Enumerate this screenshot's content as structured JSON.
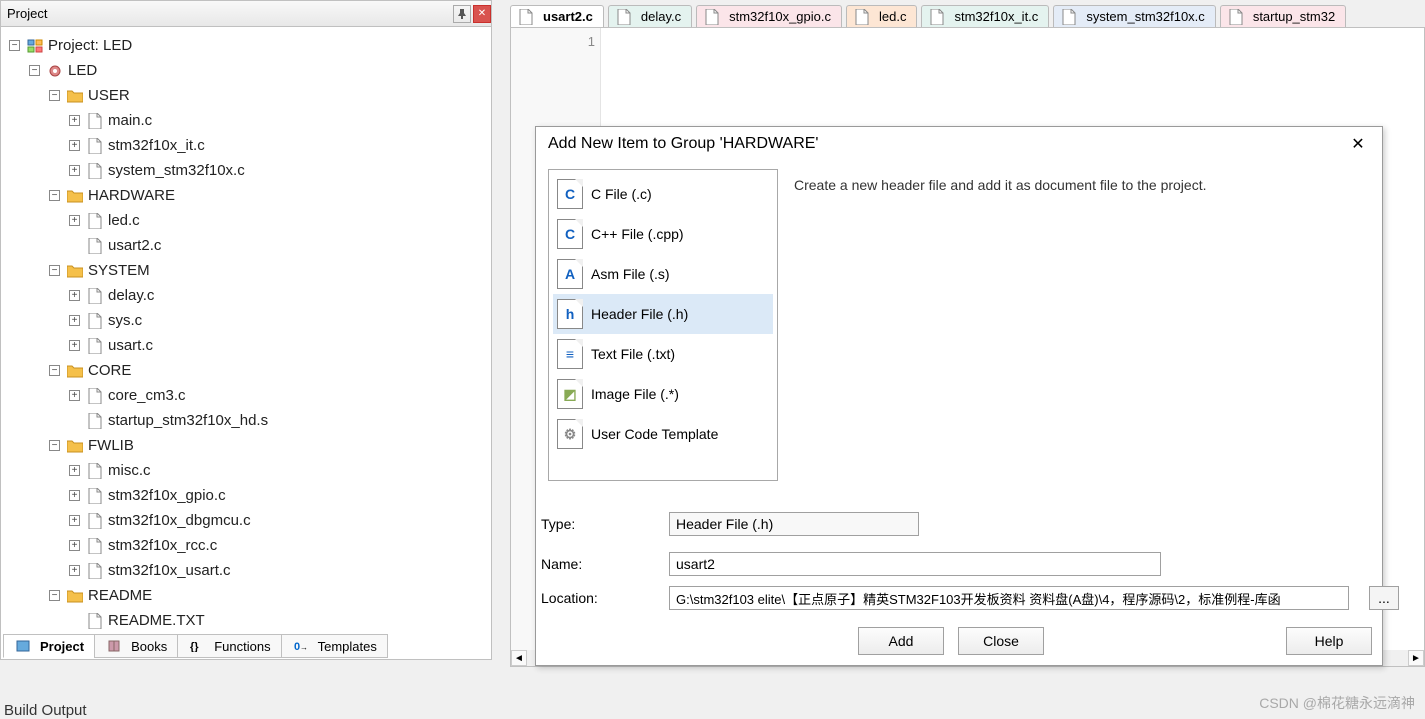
{
  "project_panel": {
    "title": "Project",
    "root": "Project: LED",
    "target": "LED",
    "groups": [
      {
        "name": "USER",
        "files": [
          "main.c",
          "stm32f10x_it.c",
          "system_stm32f10x.c"
        ]
      },
      {
        "name": "HARDWARE",
        "files": [
          "led.c",
          "usart2.c"
        ]
      },
      {
        "name": "SYSTEM",
        "files": [
          "delay.c",
          "sys.c",
          "usart.c"
        ]
      },
      {
        "name": "CORE",
        "files": [
          "core_cm3.c",
          "startup_stm32f10x_hd.s"
        ]
      },
      {
        "name": "FWLIB",
        "files": [
          "misc.c",
          "stm32f10x_gpio.c",
          "stm32f10x_dbgmcu.c",
          "stm32f10x_rcc.c",
          "stm32f10x_usart.c"
        ]
      },
      {
        "name": "README",
        "files": [
          "README.TXT"
        ]
      }
    ],
    "bottom_tabs": [
      "Project",
      "Books",
      "Functions",
      "Templates"
    ]
  },
  "editor": {
    "tabs": [
      "usart2.c",
      "delay.c",
      "stm32f10x_gpio.c",
      "led.c",
      "stm32f10x_it.c",
      "system_stm32f10x.c",
      "startup_stm32"
    ],
    "active_tab": "usart2.c",
    "line_number": "1"
  },
  "dialog": {
    "title": "Add New Item to Group 'HARDWARE'",
    "description": "Create a new header file and add it as document file to the project.",
    "types": [
      "C File (.c)",
      "C++ File (.cpp)",
      "Asm File (.s)",
      "Header File (.h)",
      "Text File (.txt)",
      "Image File (.*)",
      "User Code Template"
    ],
    "selected_type_index": 3,
    "labels": {
      "type": "Type:",
      "name": "Name:",
      "location": "Location:"
    },
    "type_value": "Header File (.h)",
    "name_value": "usart2",
    "location_value": "G:\\stm32f103 elite\\【正点原子】精英STM32F103开发板资料 资料盘(A盘)\\4，程序源码\\2，标准例程-库函",
    "buttons": {
      "add": "Add",
      "close": "Close",
      "help": "Help"
    }
  },
  "build_output_label": "Build Output",
  "watermark": "CSDN @棉花糖永远滴神"
}
